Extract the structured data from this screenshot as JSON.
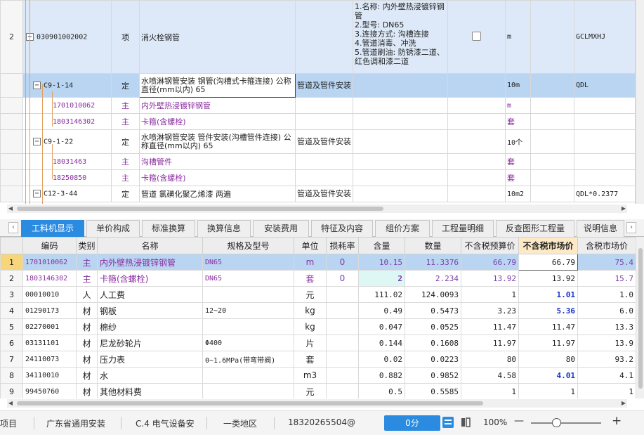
{
  "upper_grid": {
    "rows": [
      {
        "no": "2",
        "code": "030901002002",
        "type": "项",
        "name": "消火栓钢管",
        "features": "1.名称: 内外壁热浸镀锌钢管\n2.型号: DN65\n3.连接方式: 沟槽连接\n4.管道消毒、冲洗\n5.管道刷油: 防锈漆二道、红色调和漆二道",
        "unit": "m",
        "qty_expr": "GCLMXHJ"
      },
      {
        "no": "",
        "code": "C9-1-14",
        "type": "定",
        "name": "水喷淋钢管安装 钢管(沟槽式卡箍连接) 公称直径(mm以内) 65",
        "major": "管道及管件安装",
        "unit": "10m",
        "qty_expr": "QDL"
      },
      {
        "no": "",
        "code": "1701010062",
        "type": "主",
        "name": "内外壁热浸镀锌钢管",
        "unit": "m"
      },
      {
        "no": "",
        "code": "1803146302",
        "type": "主",
        "name": "卡箍(含螺栓)",
        "unit": "套"
      },
      {
        "no": "",
        "code": "C9-1-22",
        "type": "定",
        "name": "水喷淋钢管安装 管件安装(沟槽管件连接) 公称直径(mm以内) 65",
        "major": "管道及管件安装",
        "unit": "10个"
      },
      {
        "no": "",
        "code": "18031463",
        "type": "主",
        "name": "沟槽管件",
        "unit": "套"
      },
      {
        "no": "",
        "code": "18250850",
        "type": "主",
        "name": "卡箍(含螺栓)",
        "unit": "套"
      },
      {
        "no": "",
        "code": "C12-3-44",
        "type": "定",
        "name": "管道 氯磺化聚乙烯漆 两遍",
        "major": "管道及管件安装",
        "unit": "10m2",
        "qty_expr": "QDL*0.2377"
      }
    ],
    "toggle_minus": "−"
  },
  "tabs": [
    "工料机显示",
    "单价构成",
    "标准换算",
    "换算信息",
    "安装费用",
    "特征及内容",
    "组价方案",
    "工程量明细",
    "反查图形工程量",
    "说明信息"
  ],
  "lower_grid": {
    "headers": [
      "编码",
      "类别",
      "名称",
      "规格及型号",
      "单位",
      "损耗率",
      "含量",
      "数量",
      "不含税预算价",
      "不含税市场价",
      "含税市场价"
    ],
    "rows": [
      {
        "no": "1",
        "code": "1701010062",
        "cat": "主",
        "name": "内外壁热浸镀锌钢管",
        "spec": "DN65",
        "unit": "m",
        "loss": "0",
        "content": "10.15",
        "qty": "11.3376",
        "budget": "66.79",
        "market": "66.79",
        "taxed": "75.4"
      },
      {
        "no": "2",
        "code": "1803146302",
        "cat": "主",
        "name": "卡箍(含螺栓)",
        "spec": "DN65",
        "unit": "套",
        "loss": "0",
        "content": "2",
        "qty": "2.234",
        "budget": "13.92",
        "market": "13.92",
        "taxed": "15.7"
      },
      {
        "no": "3",
        "code": "00010010",
        "cat": "人",
        "name": "人工费",
        "spec": "",
        "unit": "元",
        "loss": "",
        "content": "111.02",
        "qty": "124.0093",
        "budget": "1",
        "market": "1.01",
        "taxed": "1.0"
      },
      {
        "no": "4",
        "code": "01290173",
        "cat": "材",
        "name": "钢板",
        "spec": "12~20",
        "unit": "kg",
        "loss": "",
        "content": "0.49",
        "qty": "0.5473",
        "budget": "3.23",
        "market": "5.36",
        "taxed": "6.0"
      },
      {
        "no": "5",
        "code": "02270001",
        "cat": "材",
        "name": "棉纱",
        "spec": "",
        "unit": "kg",
        "loss": "",
        "content": "0.047",
        "qty": "0.0525",
        "budget": "11.47",
        "market": "11.47",
        "taxed": "13.3"
      },
      {
        "no": "6",
        "code": "03131101",
        "cat": "材",
        "name": "尼龙砂轮片",
        "spec": "Φ400",
        "unit": "片",
        "loss": "",
        "content": "0.144",
        "qty": "0.1608",
        "budget": "11.97",
        "market": "11.97",
        "taxed": "13.9"
      },
      {
        "no": "7",
        "code": "24110073",
        "cat": "材",
        "name": "压力表",
        "spec": "0~1.6MPa(带弯带阀)",
        "unit": "套",
        "loss": "",
        "content": "0.02",
        "qty": "0.0223",
        "budget": "80",
        "market": "80",
        "taxed": "93.2"
      },
      {
        "no": "8",
        "code": "34110010",
        "cat": "材",
        "name": "水",
        "spec": "",
        "unit": "m3",
        "loss": "",
        "content": "0.882",
        "qty": "0.9852",
        "budget": "4.58",
        "market": "4.01",
        "taxed": "4.1"
      },
      {
        "no": "9",
        "code": "99450760",
        "cat": "材",
        "name": "其他材料费",
        "spec": "",
        "unit": "元",
        "loss": "",
        "content": "0.5",
        "qty": "0.5585",
        "budget": "1",
        "market": "1",
        "taxed": "1"
      }
    ]
  },
  "status_bar": {
    "project": "项目",
    "rule": "广东省通用安装",
    "section": "C.4 电气设备安",
    "region": "一类地区",
    "phone": "18320265504@",
    "score": "0分",
    "zoom": "100%",
    "minus": "—",
    "plus": "+"
  },
  "colors": {
    "accent": "#2a8be0",
    "selected_row": "#b9d5f2",
    "main_material": "#8a2ea0",
    "highlight_header": "#fde9c6"
  }
}
